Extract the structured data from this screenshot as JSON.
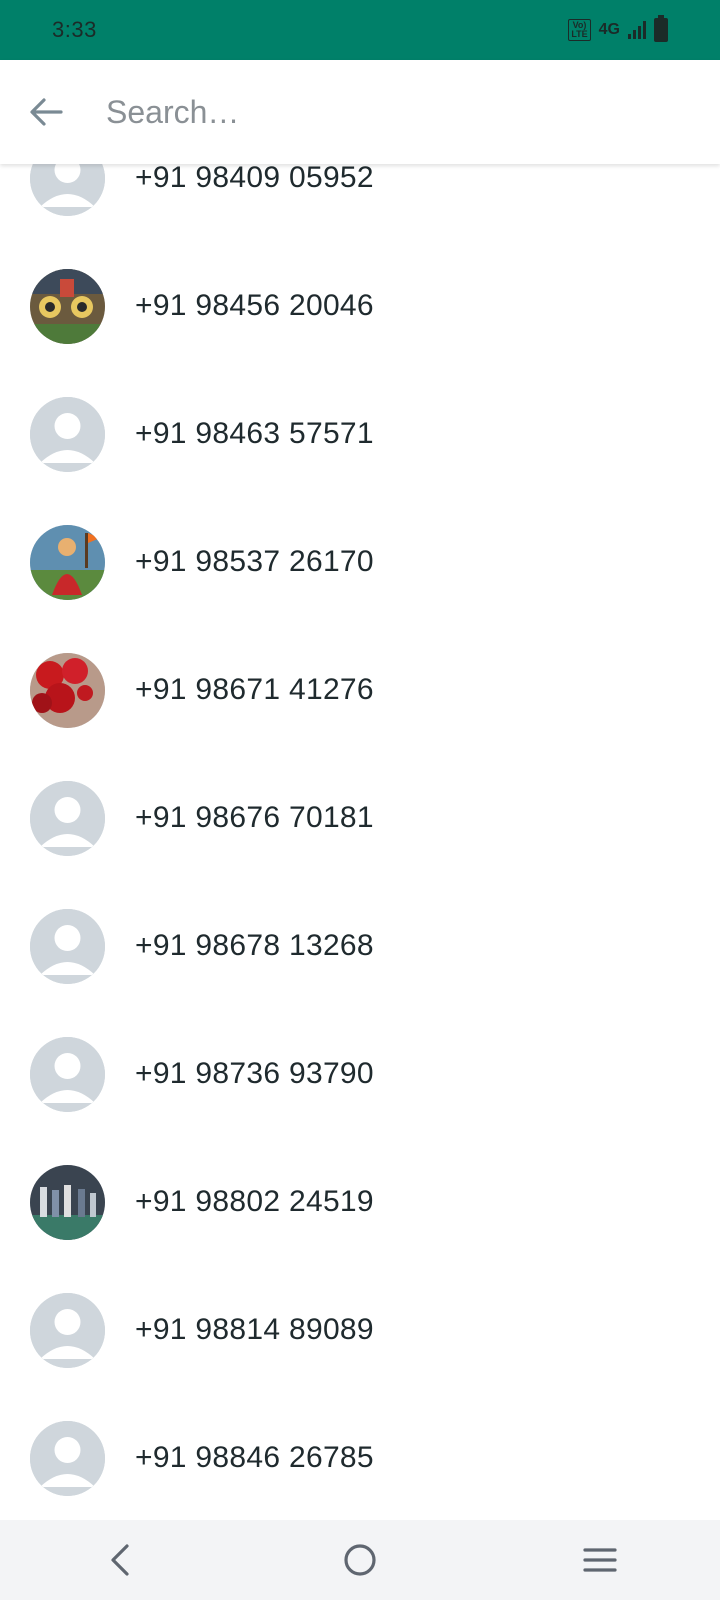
{
  "status_bar": {
    "time": "3:33",
    "volte_top": "Vo)",
    "volte_bottom": "LTE",
    "network": "4G"
  },
  "search": {
    "placeholder": "Search…",
    "back_icon": "arrow-left-icon"
  },
  "contacts": [
    {
      "phone": "+91 98409 05952",
      "avatar": "default"
    },
    {
      "phone": "+91 98456 20046",
      "avatar": "photo-temple"
    },
    {
      "phone": "+91 98463 57571",
      "avatar": "default"
    },
    {
      "phone": "+91 98537 26170",
      "avatar": "photo-goddess"
    },
    {
      "phone": "+91 98671 41276",
      "avatar": "photo-roses"
    },
    {
      "phone": "+91 98676 70181",
      "avatar": "default"
    },
    {
      "phone": "+91 98678 13268",
      "avatar": "default"
    },
    {
      "phone": "+91 98736 93790",
      "avatar": "default"
    },
    {
      "phone": "+91 98802 24519",
      "avatar": "photo-group"
    },
    {
      "phone": "+91 98814 89089",
      "avatar": "default"
    },
    {
      "phone": "+91 98846 26785",
      "avatar": "default"
    }
  ],
  "nav_bar": {
    "back_icon": "nav-back-icon",
    "home_icon": "nav-home-icon",
    "menu_icon": "nav-menu-icon"
  },
  "colors": {
    "status_bar": "#008069",
    "avatar_placeholder": "#cfd6dc",
    "text_primary": "#1f2a2e",
    "placeholder": "#8a9095"
  }
}
